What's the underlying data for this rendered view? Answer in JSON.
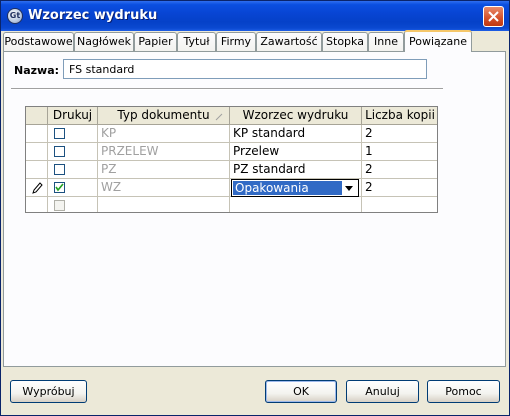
{
  "window": {
    "title": "Wzorzec wydruku",
    "icon_name": "app-logo-icon",
    "icon_text": "Gt",
    "close_icon": "close-icon"
  },
  "tabs": [
    {
      "label": "Podstawowe"
    },
    {
      "label": "Nagłówek"
    },
    {
      "label": "Papier"
    },
    {
      "label": "Tytuł"
    },
    {
      "label": "Firmy"
    },
    {
      "label": "Zawartość"
    },
    {
      "label": "Stopka"
    },
    {
      "label": "Inne"
    },
    {
      "label": "Powiązane",
      "active": true
    }
  ],
  "name_field": {
    "label": "Nazwa:",
    "value": "FS standard"
  },
  "grid": {
    "columns": [
      "Drukuj",
      "Typ dokumentu",
      "Wzorzec wydruku",
      "Liczba kopii"
    ],
    "sort_icon": "sort-indicator-icon",
    "edit_indicator_icon": "pencil-icon",
    "rows": [
      {
        "print": false,
        "doc_type": "KP",
        "template": "KP standard",
        "copies": "2"
      },
      {
        "print": false,
        "doc_type": "PRZELEW",
        "template": "Przelew",
        "copies": "1"
      },
      {
        "print": false,
        "doc_type": "PZ",
        "template": "PZ standard",
        "copies": "2"
      },
      {
        "print": true,
        "doc_type": "WZ",
        "template": "Opakowania",
        "copies": "2",
        "editing": true
      },
      {
        "print": false,
        "doc_type": "",
        "template": "",
        "copies": "",
        "new_row": true
      }
    ]
  },
  "buttons": {
    "try": "Wypróbuj",
    "ok": "OK",
    "cancel": "Anuluj",
    "help": "Pomoc"
  },
  "colors": {
    "title_bar": "#0845d4",
    "selection": "#316ac5",
    "active_tab_accent": "#f5c76a"
  }
}
